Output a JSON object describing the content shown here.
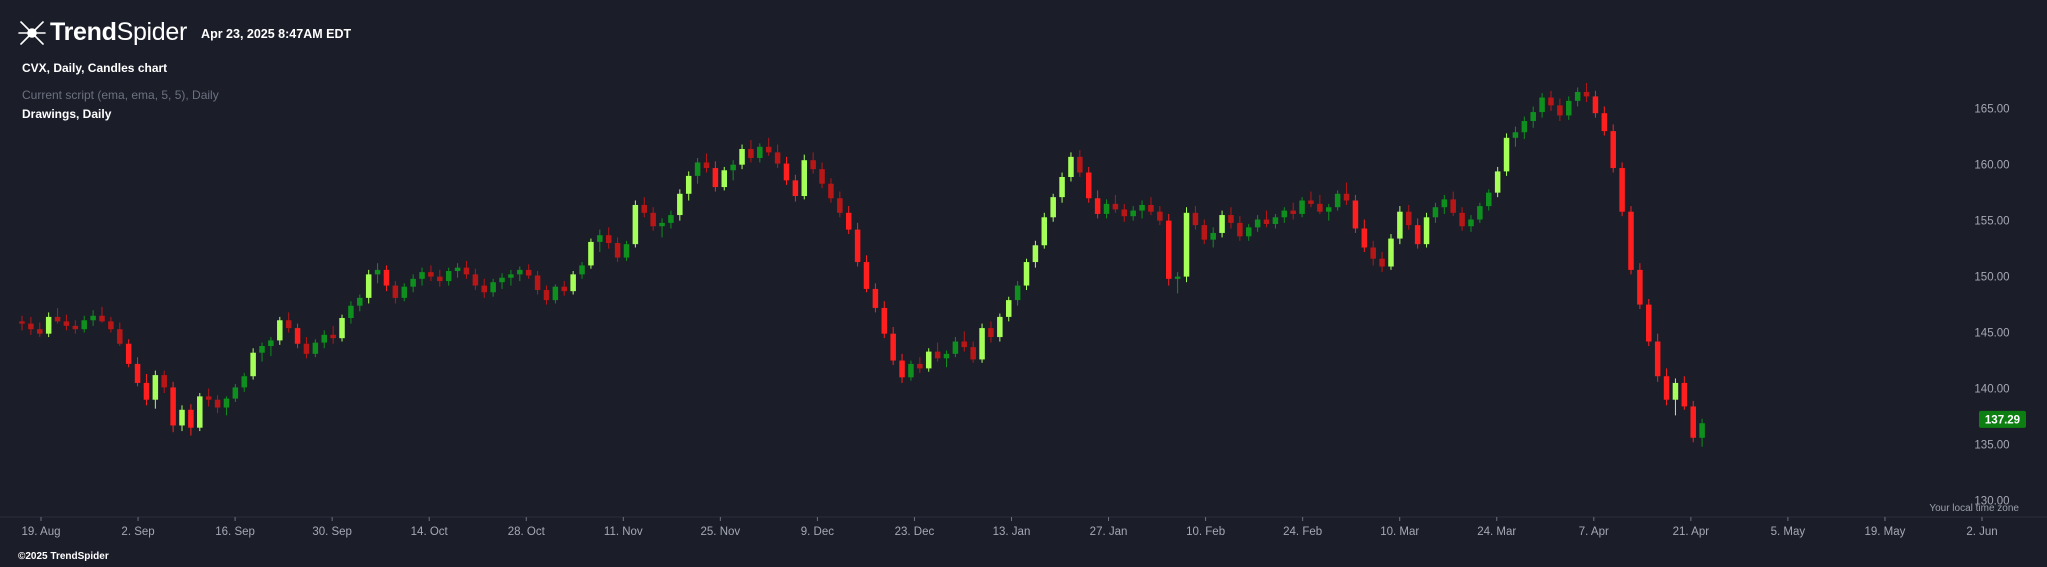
{
  "header": {
    "brand_bold": "Trend",
    "brand_light": "Spider",
    "date": "Apr 23, 2025 8:47AM EDT"
  },
  "info": {
    "chart_title": "CVX, Daily, Candles chart",
    "script_line": "Current script (ema, ema, 5, 5), Daily",
    "drawings_line": "Drawings, Daily"
  },
  "footer": {
    "copyright": "©2025 TrendSpider"
  },
  "time_zone_note": "Your local time zone",
  "colors": {
    "background": "#1b1d29",
    "bull_strong": "#a6ff59",
    "bull": "#0e8f1e",
    "bear": "#ff1f1f",
    "bear_dark": "#b81717",
    "price_label": "#0d7f12",
    "axis_text": "#a5a9b5"
  },
  "chart_data": {
    "type": "candlestick",
    "symbol": "CVX",
    "interval": "Daily",
    "y_ticks": [
      "130.00",
      "135.00",
      "140.00",
      "145.00",
      "150.00",
      "155.00",
      "160.00",
      "165.00"
    ],
    "ylim": [
      128.7,
      169.8
    ],
    "x_ticks": [
      "19. Aug",
      "2. Sep",
      "16. Sep",
      "30. Sep",
      "14. Oct",
      "28. Oct",
      "11. Nov",
      "25. Nov",
      "9. Dec",
      "23. Dec",
      "13. Jan",
      "27. Jan",
      "10. Feb",
      "24. Feb",
      "10. Mar",
      "24. Mar",
      "7. Apr",
      "21. Apr",
      "5. May",
      "19. May",
      "2. Jun"
    ],
    "last_price": "137.29",
    "candles": [
      [
        146.0,
        146.5,
        145.2,
        145.8
      ],
      [
        145.8,
        146.4,
        144.8,
        145.3
      ],
      [
        145.3,
        145.9,
        144.6,
        144.9
      ],
      [
        144.9,
        146.8,
        144.6,
        146.4
      ],
      [
        146.4,
        147.2,
        145.8,
        146.0
      ],
      [
        146.0,
        146.6,
        145.2,
        145.6
      ],
      [
        145.6,
        146.1,
        144.9,
        145.3
      ],
      [
        145.3,
        146.5,
        145.0,
        146.1
      ],
      [
        146.1,
        147.0,
        145.6,
        146.5
      ],
      [
        146.5,
        147.3,
        145.9,
        146.0
      ],
      [
        146.0,
        146.4,
        145.0,
        145.3
      ],
      [
        145.3,
        145.9,
        143.8,
        144.0
      ],
      [
        144.0,
        144.4,
        141.9,
        142.2
      ],
      [
        142.2,
        142.8,
        140.2,
        140.5
      ],
      [
        140.5,
        141.3,
        138.5,
        139.0
      ],
      [
        139.0,
        141.6,
        138.2,
        141.2
      ],
      [
        141.2,
        141.6,
        139.6,
        140.1
      ],
      [
        140.1,
        140.6,
        136.1,
        136.7
      ],
      [
        136.7,
        138.5,
        136.2,
        138.1
      ],
      [
        138.1,
        138.6,
        135.8,
        136.5
      ],
      [
        136.5,
        139.6,
        136.2,
        139.3
      ],
      [
        139.3,
        140.0,
        138.4,
        139.0
      ],
      [
        139.0,
        139.4,
        137.8,
        138.3
      ],
      [
        138.3,
        139.3,
        137.6,
        139.1
      ],
      [
        139.1,
        140.4,
        138.8,
        140.1
      ],
      [
        140.1,
        141.4,
        139.7,
        141.1
      ],
      [
        141.1,
        143.6,
        140.8,
        143.2
      ],
      [
        143.2,
        144.1,
        142.4,
        143.8
      ],
      [
        143.8,
        144.6,
        142.9,
        144.3
      ],
      [
        144.3,
        146.4,
        143.9,
        146.1
      ],
      [
        146.1,
        146.8,
        145.0,
        145.4
      ],
      [
        145.4,
        145.8,
        143.6,
        144.0
      ],
      [
        144.0,
        144.6,
        142.7,
        143.1
      ],
      [
        143.1,
        144.4,
        142.8,
        144.1
      ],
      [
        144.1,
        145.2,
        143.6,
        144.8
      ],
      [
        144.8,
        145.6,
        144.0,
        144.5
      ],
      [
        144.5,
        146.6,
        144.2,
        146.3
      ],
      [
        146.3,
        147.8,
        145.8,
        147.4
      ],
      [
        147.4,
        148.4,
        146.9,
        148.1
      ],
      [
        148.1,
        150.6,
        147.6,
        150.2
      ],
      [
        150.2,
        151.2,
        149.4,
        150.6
      ],
      [
        150.6,
        151.0,
        148.7,
        149.2
      ],
      [
        149.2,
        149.6,
        147.6,
        148.1
      ],
      [
        148.1,
        149.4,
        147.8,
        149.1
      ],
      [
        149.1,
        150.2,
        148.6,
        149.8
      ],
      [
        149.8,
        150.8,
        149.2,
        150.4
      ],
      [
        150.4,
        151.0,
        149.6,
        150.0
      ],
      [
        150.0,
        150.6,
        149.1,
        149.6
      ],
      [
        149.6,
        150.8,
        149.2,
        150.5
      ],
      [
        150.5,
        151.2,
        149.9,
        150.8
      ],
      [
        150.8,
        151.4,
        149.8,
        150.2
      ],
      [
        150.2,
        150.7,
        148.8,
        149.2
      ],
      [
        149.2,
        149.8,
        148.1,
        148.6
      ],
      [
        148.6,
        149.8,
        148.2,
        149.5
      ],
      [
        149.5,
        150.3,
        148.9,
        149.9
      ],
      [
        149.9,
        150.6,
        149.2,
        150.2
      ],
      [
        150.2,
        150.9,
        149.6,
        150.6
      ],
      [
        150.6,
        151.1,
        149.8,
        150.1
      ],
      [
        150.1,
        150.5,
        148.4,
        148.8
      ],
      [
        148.8,
        149.2,
        147.5,
        147.9
      ],
      [
        147.9,
        149.3,
        147.6,
        149.1
      ],
      [
        149.1,
        149.6,
        148.3,
        148.7
      ],
      [
        148.7,
        150.5,
        148.4,
        150.2
      ],
      [
        150.2,
        151.3,
        149.8,
        151.0
      ],
      [
        151.0,
        153.4,
        150.7,
        153.1
      ],
      [
        153.1,
        154.2,
        152.2,
        153.7
      ],
      [
        153.7,
        154.4,
        152.5,
        153.0
      ],
      [
        153.0,
        153.5,
        151.3,
        151.7
      ],
      [
        151.7,
        153.2,
        151.4,
        152.9
      ],
      [
        152.9,
        156.8,
        152.6,
        156.4
      ],
      [
        156.4,
        157.1,
        155.3,
        155.7
      ],
      [
        155.7,
        156.2,
        154.1,
        154.5
      ],
      [
        154.5,
        155.2,
        153.5,
        154.8
      ],
      [
        154.8,
        155.9,
        154.3,
        155.5
      ],
      [
        155.5,
        157.8,
        155.0,
        157.4
      ],
      [
        157.4,
        159.4,
        156.8,
        159.0
      ],
      [
        159.0,
        160.6,
        158.3,
        160.2
      ],
      [
        160.2,
        161.0,
        159.3,
        159.7
      ],
      [
        159.7,
        160.3,
        157.6,
        158.0
      ],
      [
        158.0,
        159.8,
        157.7,
        159.5
      ],
      [
        159.5,
        160.4,
        158.6,
        160.0
      ],
      [
        160.0,
        161.8,
        159.6,
        161.4
      ],
      [
        161.4,
        162.2,
        160.2,
        160.6
      ],
      [
        160.6,
        161.9,
        160.2,
        161.6
      ],
      [
        161.6,
        162.4,
        160.8,
        161.1
      ],
      [
        161.1,
        161.8,
        159.7,
        160.1
      ],
      [
        160.1,
        160.7,
        158.2,
        158.6
      ],
      [
        158.6,
        159.1,
        156.7,
        157.2
      ],
      [
        157.2,
        160.9,
        156.9,
        160.4
      ],
      [
        160.4,
        161.1,
        159.2,
        159.6
      ],
      [
        159.6,
        160.2,
        157.9,
        158.3
      ],
      [
        158.3,
        158.8,
        156.6,
        157.0
      ],
      [
        157.0,
        157.6,
        155.3,
        155.7
      ],
      [
        155.7,
        156.3,
        153.8,
        154.2
      ],
      [
        154.2,
        154.8,
        150.9,
        151.3
      ],
      [
        151.3,
        151.9,
        148.6,
        148.9
      ],
      [
        148.9,
        149.4,
        146.8,
        147.2
      ],
      [
        147.2,
        147.8,
        144.5,
        144.9
      ],
      [
        144.9,
        145.5,
        142.1,
        142.5
      ],
      [
        142.5,
        143.1,
        140.5,
        141.0
      ],
      [
        141.0,
        142.5,
        140.7,
        142.2
      ],
      [
        142.2,
        142.8,
        141.4,
        141.8
      ],
      [
        141.8,
        143.6,
        141.5,
        143.3
      ],
      [
        143.3,
        144.1,
        142.4,
        142.7
      ],
      [
        142.7,
        143.4,
        141.9,
        143.1
      ],
      [
        143.1,
        144.6,
        142.8,
        144.2
      ],
      [
        144.2,
        145.1,
        143.3,
        143.7
      ],
      [
        143.7,
        144.2,
        142.3,
        142.6
      ],
      [
        142.6,
        145.8,
        142.3,
        145.4
      ],
      [
        145.4,
        146.0,
        144.1,
        144.6
      ],
      [
        144.6,
        146.7,
        144.2,
        146.4
      ],
      [
        146.4,
        148.2,
        146.0,
        147.9
      ],
      [
        147.9,
        149.6,
        147.4,
        149.2
      ],
      [
        149.2,
        151.6,
        148.8,
        151.3
      ],
      [
        151.3,
        153.2,
        150.8,
        152.8
      ],
      [
        152.8,
        155.7,
        152.5,
        155.3
      ],
      [
        155.3,
        157.4,
        154.9,
        157.1
      ],
      [
        157.1,
        159.3,
        156.6,
        158.9
      ],
      [
        158.9,
        161.1,
        158.5,
        160.7
      ],
      [
        160.7,
        161.3,
        158.9,
        159.3
      ],
      [
        159.3,
        159.8,
        156.6,
        157.0
      ],
      [
        157.0,
        157.7,
        155.2,
        155.6
      ],
      [
        155.6,
        156.9,
        155.2,
        156.5
      ],
      [
        156.5,
        157.3,
        155.7,
        156.0
      ],
      [
        156.0,
        156.5,
        154.9,
        155.4
      ],
      [
        155.4,
        156.3,
        155.0,
        155.9
      ],
      [
        155.9,
        156.8,
        155.2,
        156.4
      ],
      [
        156.4,
        157.1,
        155.5,
        155.8
      ],
      [
        155.8,
        156.3,
        154.6,
        155.0
      ],
      [
        155.0,
        155.6,
        149.2,
        149.8
      ],
      [
        149.8,
        150.4,
        148.5,
        150.0
      ],
      [
        150.0,
        156.2,
        149.5,
        155.7
      ],
      [
        155.7,
        156.3,
        154.2,
        154.6
      ],
      [
        154.6,
        155.1,
        152.9,
        153.3
      ],
      [
        153.3,
        154.4,
        152.6,
        153.9
      ],
      [
        153.9,
        155.9,
        153.5,
        155.5
      ],
      [
        155.5,
        156.2,
        154.3,
        154.8
      ],
      [
        154.8,
        155.4,
        153.2,
        153.6
      ],
      [
        153.6,
        154.7,
        153.2,
        154.4
      ],
      [
        154.4,
        155.5,
        154.0,
        155.1
      ],
      [
        155.1,
        155.9,
        154.4,
        154.7
      ],
      [
        154.7,
        155.6,
        154.3,
        155.3
      ],
      [
        155.3,
        156.2,
        154.8,
        155.9
      ],
      [
        155.9,
        156.6,
        155.1,
        155.6
      ],
      [
        155.6,
        157.1,
        155.3,
        156.8
      ],
      [
        156.8,
        157.6,
        156.2,
        156.5
      ],
      [
        156.5,
        157.3,
        155.6,
        155.8
      ],
      [
        155.8,
        156.5,
        155.0,
        156.2
      ],
      [
        156.2,
        157.7,
        155.9,
        157.4
      ],
      [
        157.4,
        158.4,
        156.4,
        156.8
      ],
      [
        156.8,
        157.3,
        153.9,
        154.3
      ],
      [
        154.3,
        155.1,
        152.2,
        152.6
      ],
      [
        152.6,
        153.2,
        151.0,
        151.6
      ],
      [
        151.6,
        152.2,
        150.4,
        150.9
      ],
      [
        150.9,
        153.8,
        150.6,
        153.4
      ],
      [
        153.4,
        156.3,
        152.9,
        155.8
      ],
      [
        155.8,
        156.4,
        154.2,
        154.6
      ],
      [
        154.6,
        155.2,
        152.5,
        152.9
      ],
      [
        152.9,
        155.7,
        152.6,
        155.3
      ],
      [
        155.3,
        156.6,
        154.8,
        156.2
      ],
      [
        156.2,
        157.3,
        155.6,
        156.9
      ],
      [
        156.9,
        157.6,
        155.4,
        155.7
      ],
      [
        155.7,
        156.2,
        154.1,
        154.5
      ],
      [
        154.5,
        155.5,
        154.0,
        155.1
      ],
      [
        155.1,
        156.6,
        154.8,
        156.3
      ],
      [
        156.3,
        157.8,
        155.9,
        157.5
      ],
      [
        157.5,
        159.8,
        157.1,
        159.4
      ],
      [
        159.4,
        162.8,
        159.0,
        162.4
      ],
      [
        162.4,
        163.4,
        161.6,
        162.9
      ],
      [
        162.9,
        164.3,
        162.3,
        163.9
      ],
      [
        163.9,
        165.2,
        163.3,
        164.7
      ],
      [
        164.7,
        166.4,
        164.2,
        166.0
      ],
      [
        166.0,
        166.6,
        164.8,
        165.3
      ],
      [
        165.3,
        165.9,
        163.9,
        164.4
      ],
      [
        164.4,
        166.1,
        164.0,
        165.7
      ],
      [
        165.7,
        166.9,
        165.2,
        166.5
      ],
      [
        166.5,
        167.3,
        165.6,
        166.1
      ],
      [
        166.1,
        166.6,
        164.2,
        164.6
      ],
      [
        164.6,
        165.2,
        162.6,
        163.0
      ],
      [
        163.0,
        163.6,
        159.3,
        159.7
      ],
      [
        159.7,
        160.2,
        155.4,
        155.8
      ],
      [
        155.8,
        156.3,
        150.2,
        150.6
      ],
      [
        150.6,
        151.2,
        147.1,
        147.5
      ],
      [
        147.5,
        148.0,
        143.8,
        144.2
      ],
      [
        144.2,
        144.9,
        140.6,
        141.1
      ],
      [
        141.1,
        141.8,
        138.5,
        139.0
      ],
      [
        139.0,
        140.9,
        137.6,
        140.5
      ],
      [
        140.5,
        141.1,
        138.1,
        138.4
      ],
      [
        138.4,
        138.9,
        135.2,
        135.6
      ],
      [
        135.6,
        137.3,
        134.8,
        136.9
      ]
    ]
  }
}
